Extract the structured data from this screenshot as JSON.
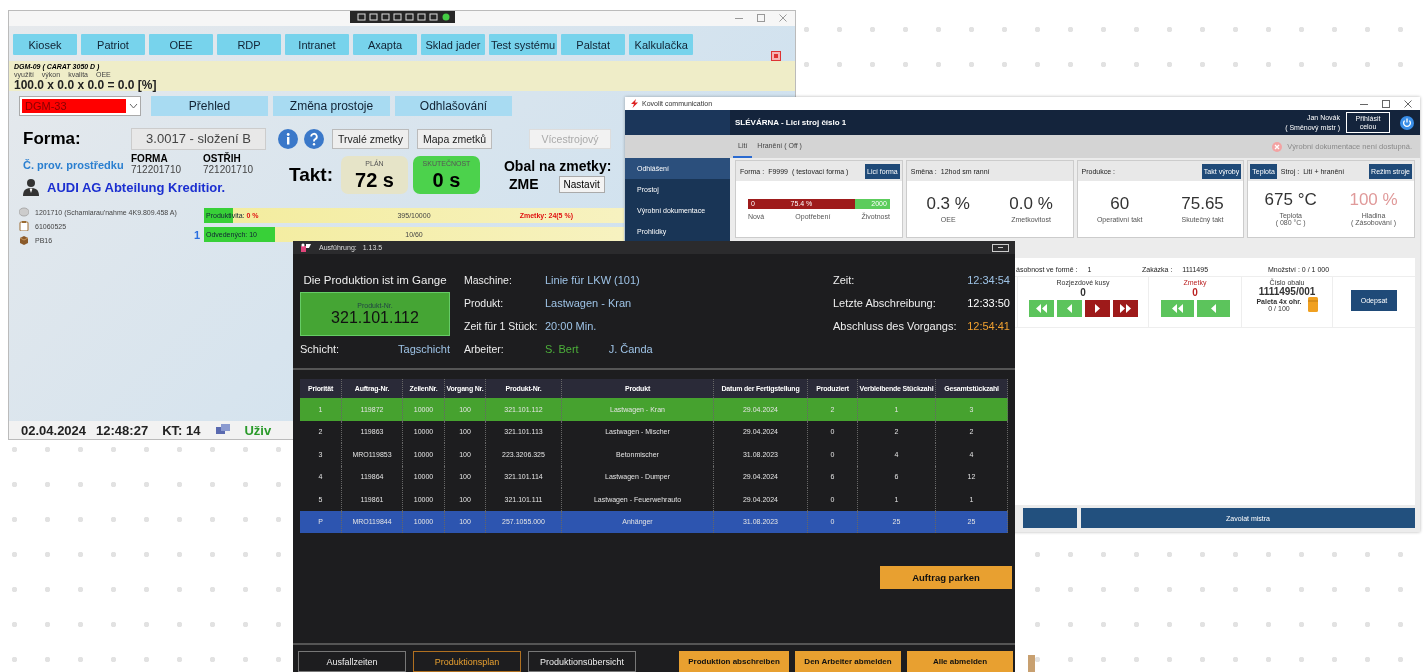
{
  "window_foundry": {
    "nav_buttons": [
      "Kiosek",
      "Patriot",
      "OEE",
      "RDP",
      "Intranet",
      "Axapta",
      "Sklad jader",
      "Test systému",
      "Palstat",
      "Kalkulačka"
    ],
    "oee": {
      "machine": "DGM-09 ( CARAT 3050 D )",
      "labels": [
        "využití",
        "výkon",
        "kvalita",
        "OEE"
      ],
      "formula": "100.0 x 0.0 x 0.0 = 0.0 [%]"
    },
    "machine_select": {
      "value": "DGM-33"
    },
    "action_buttons": [
      "Přehled",
      "Změna prostoje",
      "Odhlašování"
    ],
    "form": {
      "label": "Forma:",
      "value": "3.0017 - složení B"
    },
    "tool_buttons": [
      {
        "label": "Trvalé zmetky",
        "disabled": false
      },
      {
        "label": "Mapa zmetků",
        "disabled": false
      },
      {
        "label": "Vícestrojový",
        "disabled": true
      }
    ],
    "tool_label": "Č. prov. prostředku",
    "codes": [
      {
        "label": "FORMA",
        "value": "712201710"
      },
      {
        "label": "OSTŘIH",
        "value": "721201710"
      }
    ],
    "customer": "AUDI AG Abteilung Kreditior.",
    "takt": {
      "label": "Takt:",
      "plan_label": "PLÁN",
      "plan": "72 s",
      "actual_label": "SKUTEČNOST",
      "actual": "0 s"
    },
    "scrap_bin": {
      "label": "Obal na zmetky:",
      "value": "ZME",
      "button": "Nastavit"
    },
    "items": [
      {
        "kind": "disk",
        "text": "1201710 (Schamiarau'nahme 4K9.809.458 A)"
      },
      {
        "kind": "clipboard",
        "text": "61060525"
      },
      {
        "kind": "box",
        "text": "PB16"
      }
    ],
    "bars": [
      {
        "label": "Produktivita:",
        "value": "0 %",
        "level": 0.07,
        "count": "395/10000",
        "scrap": "Zmetky: 24(5 %)"
      },
      {
        "marker": "1",
        "label": "Odvedených: 10",
        "level": 0.17,
        "count": "10/60"
      }
    ],
    "status_bar": {
      "date": "02.04.2024",
      "time": "12:48:27",
      "kt": "KT: 14",
      "user": "Uživ"
    }
  },
  "window_kovolit": {
    "title": "Kovolit communication",
    "header": {
      "title": "SLÉVÁRNA - Licí stroj číslo 1",
      "user": "Jan Novák",
      "role": "( Směnový mistr )",
      "login_button": "Přihlásit celou"
    },
    "tabs": [
      {
        "label": "Lití",
        "selected": true
      },
      {
        "label": "Hranění ( Off )",
        "selected": false
      }
    ],
    "notice": "Výrobní dokumentace není dostupná.",
    "sidebar": [
      {
        "label": "Odhlášení",
        "selected": true
      },
      {
        "label": "Prostoj",
        "selected": false
      },
      {
        "label": "Výrobní dokumentace",
        "selected": false
      },
      {
        "label": "Prohlídky",
        "selected": false
      }
    ],
    "cards": [
      {
        "kind": "wear",
        "title": "Forma :",
        "value": "F9999",
        "note": "( testovací forma )",
        "button": "Licí forma",
        "bar": {
          "start": "0",
          "level": 0.754,
          "reading": "75.4 %",
          "end": "2000"
        },
        "captions": [
          "Nová",
          "Opotřebení",
          "Životnost"
        ]
      },
      {
        "kind": "metrics",
        "title": "Směna :",
        "value": "12hod sm ranní",
        "metrics": [
          {
            "value": "0.3 %",
            "label": "OEE",
            "disabled": false
          },
          {
            "value": "0.0 %",
            "label": "Zmetkovitost",
            "disabled": false
          }
        ]
      },
      {
        "kind": "metrics",
        "title": "Produkce :",
        "button": "Takt výroby",
        "metrics": [
          {
            "value": "60",
            "label": "Operativní takt",
            "disabled": false
          },
          {
            "value": "75.65",
            "label": "Skutečný takt",
            "disabled": false
          }
        ]
      },
      {
        "kind": "metrics",
        "lead_button": "Teplota",
        "title": "Stroj :",
        "value": "Lití + hranění",
        "button": "Režim stroje",
        "metrics": [
          {
            "value": "675 °C",
            "label": "Teplota",
            "sub": "( 080 °C )",
            "disabled": false
          },
          {
            "value": "100 %",
            "label": "Hladina",
            "sub": "( Zásobování )",
            "disabled": true
          }
        ]
      }
    ],
    "order_info": [
      {
        "label": "ásobnost ve formě :",
        "value": "1"
      },
      {
        "label": "Zakázka :",
        "value": "1111495"
      },
      {
        "label": "Množství : 0 / 1 000"
      }
    ],
    "counters": [
      {
        "kind": "stepper",
        "title": "Rozjezdové kusy",
        "value": "0",
        "alert": false,
        "steps": [
          {
            "kind": "fast-back",
            "color": "#5cc45c"
          },
          {
            "kind": "back",
            "color": "#5cc45c"
          },
          {
            "kind": "forward",
            "color": "#9e1a1a"
          },
          {
            "kind": "fast-forward",
            "color": "#9e1a1a"
          }
        ]
      },
      {
        "kind": "stepper",
        "title": "Zmetky",
        "value": "0",
        "alert": true,
        "steps": [
          {
            "kind": "fast-back",
            "color": "#5cc45c"
          },
          {
            "kind": "back",
            "color": "#5cc45c"
          }
        ]
      },
      {
        "kind": "package",
        "title": "Číslo obalu",
        "value": "1111495/001",
        "note": "Paleta 4x ohr.",
        "count": "0 / 100"
      },
      {
        "kind": "action",
        "button": "Odepsat"
      }
    ],
    "call_button": "Zavolat mistra"
  },
  "window_execution": {
    "title": "Ausführung:",
    "version": "1.13.5",
    "status": "Die Produktion ist im Gange",
    "product_box": {
      "label": "Produkt-Nr.",
      "value": "321.101.112"
    },
    "shift": {
      "label": "Schicht:",
      "value": "Tagschicht"
    },
    "details": [
      {
        "label": "Maschine:",
        "values": [
          {
            "text": "Linie für LKW (101)",
            "color": "#9ec3e6"
          }
        ]
      },
      {
        "label": "Produkt:",
        "values": [
          {
            "text": "Lastwagen - Kran",
            "color": "#9ec3e6"
          }
        ]
      },
      {
        "label": "Zeit für 1 Stück:",
        "values": [
          {
            "text": "20:00 Min.",
            "color": "#9ec3e6"
          }
        ]
      },
      {
        "label": "Arbeiter:",
        "values": [
          {
            "text": "S. Bert",
            "color": "#4caf3a"
          },
          {
            "text": "J. Čanda",
            "color": "#9ec3e6"
          }
        ]
      }
    ],
    "times": [
      {
        "label": "Zeit:",
        "value": "12:34:54",
        "color": "#9ec3e6"
      },
      {
        "label": "Letzte Abschreibung:",
        "value": "12:33:50",
        "color": "#ffffff"
      },
      {
        "label": "Abschluss des Vorgangs:",
        "value": "12:54:41",
        "color": "#f0a030"
      }
    ],
    "table": {
      "columns": [
        "Priorität",
        "Auftrag-Nr.",
        "ZeilenNr.",
        "Vorgang Nr.",
        "Produkt-Nr.",
        "Produkt",
        "Datum der Fertigstellung",
        "Produziert",
        "Verbleibende Stückzahl",
        "Gesamtstückzahl"
      ],
      "rows": [
        {
          "cells": [
            "1",
            "119872",
            "10000",
            "100",
            "321.101.112",
            "Lastwagen - Kran",
            "29.04.2024",
            "2",
            "1",
            "3"
          ],
          "running": true,
          "selected": false
        },
        {
          "cells": [
            "2",
            "119863",
            "10000",
            "100",
            "321.101.113",
            "Lastwagen - Mischer",
            "29.04.2024",
            "0",
            "2",
            "2"
          ],
          "running": false,
          "selected": false
        },
        {
          "cells": [
            "3",
            "MRO119853",
            "10000",
            "100",
            "223.3206.325",
            "Betonmischer",
            "31.08.2023",
            "0",
            "4",
            "4"
          ],
          "running": false,
          "selected": false
        },
        {
          "cells": [
            "4",
            "119864",
            "10000",
            "100",
            "321.101.114",
            "Lastwagen - Dumper",
            "29.04.2024",
            "6",
            "6",
            "12"
          ],
          "running": false,
          "selected": false
        },
        {
          "cells": [
            "5",
            "119861",
            "10000",
            "100",
            "321.101.111",
            "Lastwagen - Feuerwehrauto",
            "29.04.2024",
            "0",
            "1",
            "1"
          ],
          "running": false,
          "selected": false
        },
        {
          "cells": [
            "P",
            "MRO119844",
            "10000",
            "100",
            "257.1055.000",
            "Anhänger",
            "31.08.2023",
            "0",
            "25",
            "25"
          ],
          "running": false,
          "selected": true
        }
      ]
    },
    "park_button": "Auftrag parken",
    "tabs": [
      {
        "label": "Ausfallzeiten",
        "selected": false
      },
      {
        "label": "Produktionsplan",
        "selected": true
      },
      {
        "label": "Produktionsübersicht",
        "selected": false
      }
    ],
    "actions": [
      "Produktion abschreiben",
      "Den Arbeiter abmelden",
      "Alle abmelden"
    ]
  }
}
